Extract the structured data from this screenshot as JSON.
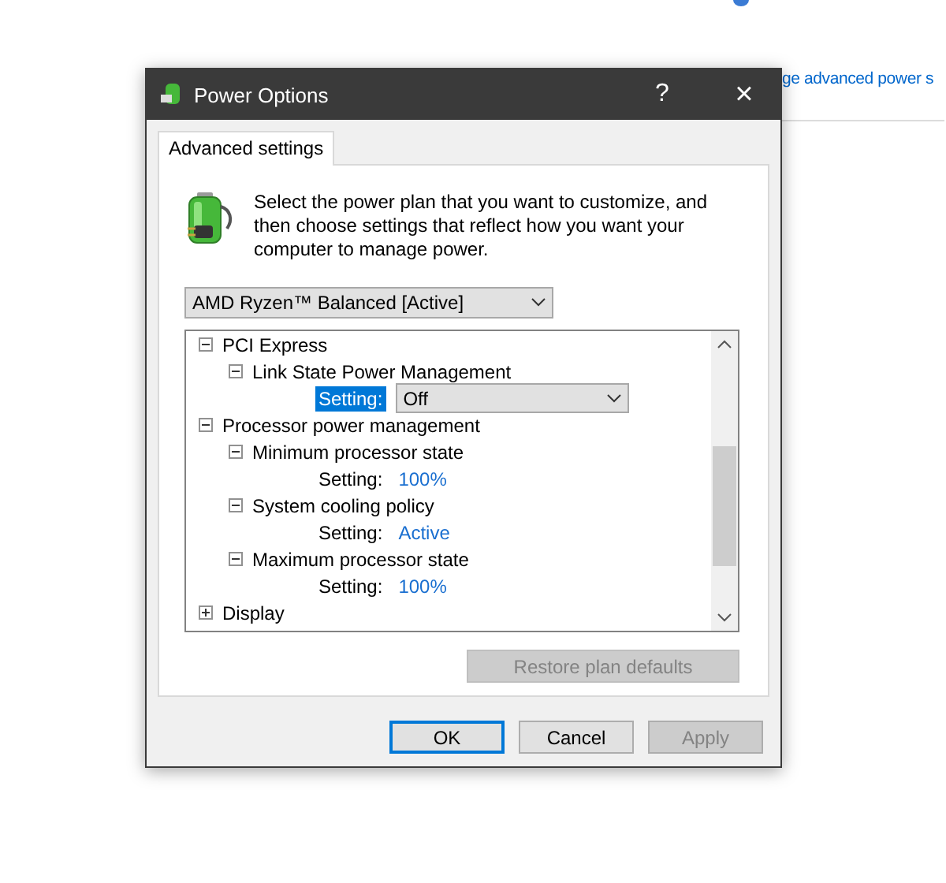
{
  "page": {
    "link": "ge advanced power s"
  },
  "window": {
    "title": "Power Options",
    "help": "?",
    "close": "×"
  },
  "tabs": [
    {
      "label": "Advanced settings",
      "selected": true
    }
  ],
  "intro": "Select the power plan that you want to customize, and then choose settings that reflect how you want your computer to manage power.",
  "plan_select": {
    "value": "AMD Ryzen™ Balanced [Active]"
  },
  "tree": [
    {
      "kind": "group",
      "label": "PCI Express",
      "expanded": true,
      "children": [
        {
          "kind": "group",
          "label": "Link State Power Management",
          "expanded": true,
          "children": [
            {
              "kind": "setting",
              "label": "Setting:",
              "value": "Off",
              "selected": true
            }
          ]
        }
      ]
    },
    {
      "kind": "group",
      "label": "Processor power management",
      "expanded": true,
      "children": [
        {
          "kind": "group",
          "label": "Minimum processor state",
          "expanded": true,
          "children": [
            {
              "kind": "setting",
              "label": "Setting:",
              "value": "100%",
              "selected": false
            }
          ]
        },
        {
          "kind": "group",
          "label": "System cooling policy",
          "expanded": true,
          "children": [
            {
              "kind": "setting",
              "label": "Setting:",
              "value": "Active",
              "selected": false
            }
          ]
        },
        {
          "kind": "group",
          "label": "Maximum processor state",
          "expanded": true,
          "children": [
            {
              "kind": "setting",
              "label": "Setting:",
              "value": "100%",
              "selected": false
            }
          ]
        }
      ]
    },
    {
      "kind": "group",
      "label": "Display",
      "expanded": false
    }
  ],
  "restore_button": {
    "label": "Restore plan defaults",
    "disabled": true
  },
  "buttons": [
    {
      "label": "OK",
      "default": true,
      "disabled": false
    },
    {
      "label": "Cancel",
      "default": false,
      "disabled": false
    },
    {
      "label": "Apply",
      "default": false,
      "disabled": true
    }
  ]
}
